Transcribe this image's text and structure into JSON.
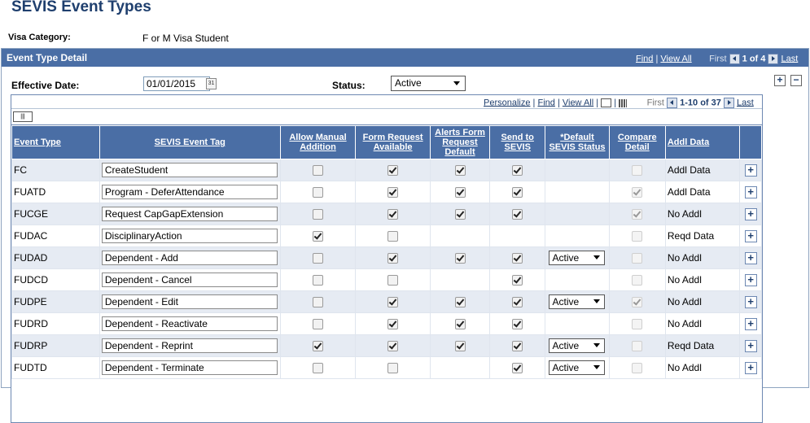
{
  "page": {
    "title": "SEVIS Event Types",
    "visa_category_label": "Visa Category:",
    "visa_category_value": "F or M Visa Student"
  },
  "detail": {
    "title": "Event Type Detail",
    "nav": {
      "find": "Find",
      "sep": "|",
      "view_all": "View All",
      "first": "First",
      "range": "1 of 4",
      "last": "Last"
    },
    "effective_date_label": "Effective Date:",
    "effective_date": "01/01/2015",
    "status_label": "Status:",
    "status_value": "Active",
    "add_label": "+",
    "remove_label": "−"
  },
  "grid": {
    "nav": {
      "personalize": "Personalize",
      "find": "Find",
      "view_all": "View All",
      "first": "First",
      "range": "1-10 of 37",
      "last": "Last"
    },
    "columns": [
      "Event Type",
      "SEVIS Event Tag",
      "Allow Manual Addition",
      "Form Request Available",
      "Alerts Form Request Default",
      "Send to SEVIS",
      "*Default SEVIS Status",
      "Compare Detail",
      "Addl Data"
    ],
    "rows": [
      {
        "event_type": "FC",
        "tag": "CreateStudent",
        "manual": false,
        "form": true,
        "alerts": true,
        "send": true,
        "status": "",
        "compare": false,
        "compare_checked": false,
        "addl": "Addl Data"
      },
      {
        "event_type": "FUATD",
        "tag": "Program - DeferAttendance",
        "manual": false,
        "form": true,
        "alerts": true,
        "send": true,
        "status": "",
        "compare": false,
        "compare_checked": true,
        "addl": "Addl Data"
      },
      {
        "event_type": "FUCGE",
        "tag": "Request CapGapExtension",
        "manual": false,
        "form": true,
        "alerts": true,
        "send": true,
        "status": "",
        "compare": false,
        "compare_checked": true,
        "addl": "No Addl"
      },
      {
        "event_type": "FUDAC",
        "tag": "DisciplinaryAction",
        "manual": true,
        "form": false,
        "alerts": null,
        "send": null,
        "status": "",
        "compare": false,
        "compare_checked": false,
        "addl": "Reqd Data"
      },
      {
        "event_type": "FUDAD",
        "tag": "Dependent - Add",
        "manual": false,
        "form": true,
        "alerts": true,
        "send": true,
        "status": "Active",
        "compare": false,
        "compare_checked": false,
        "addl": "No Addl"
      },
      {
        "event_type": "FUDCD",
        "tag": "Dependent - Cancel",
        "manual": false,
        "form": false,
        "alerts": null,
        "send": true,
        "status": "",
        "compare": false,
        "compare_checked": false,
        "addl": "No Addl"
      },
      {
        "event_type": "FUDPE",
        "tag": "Dependent - Edit",
        "manual": false,
        "form": true,
        "alerts": true,
        "send": true,
        "status": "Active",
        "compare": false,
        "compare_checked": true,
        "addl": "No Addl"
      },
      {
        "event_type": "FUDRD",
        "tag": "Dependent - Reactivate",
        "manual": false,
        "form": true,
        "alerts": true,
        "send": true,
        "status": "",
        "compare": false,
        "compare_checked": false,
        "addl": "No Addl"
      },
      {
        "event_type": "FUDRP",
        "tag": "Dependent - Reprint",
        "manual": true,
        "form": true,
        "alerts": true,
        "send": true,
        "status": "Active",
        "compare": false,
        "compare_checked": false,
        "addl": "Reqd Data"
      },
      {
        "event_type": "FUDTD",
        "tag": "Dependent - Terminate",
        "manual": false,
        "form": false,
        "alerts": null,
        "send": true,
        "status": "Active",
        "compare": false,
        "compare_checked": false,
        "addl": "No Addl"
      }
    ],
    "row_add_label": "+"
  }
}
